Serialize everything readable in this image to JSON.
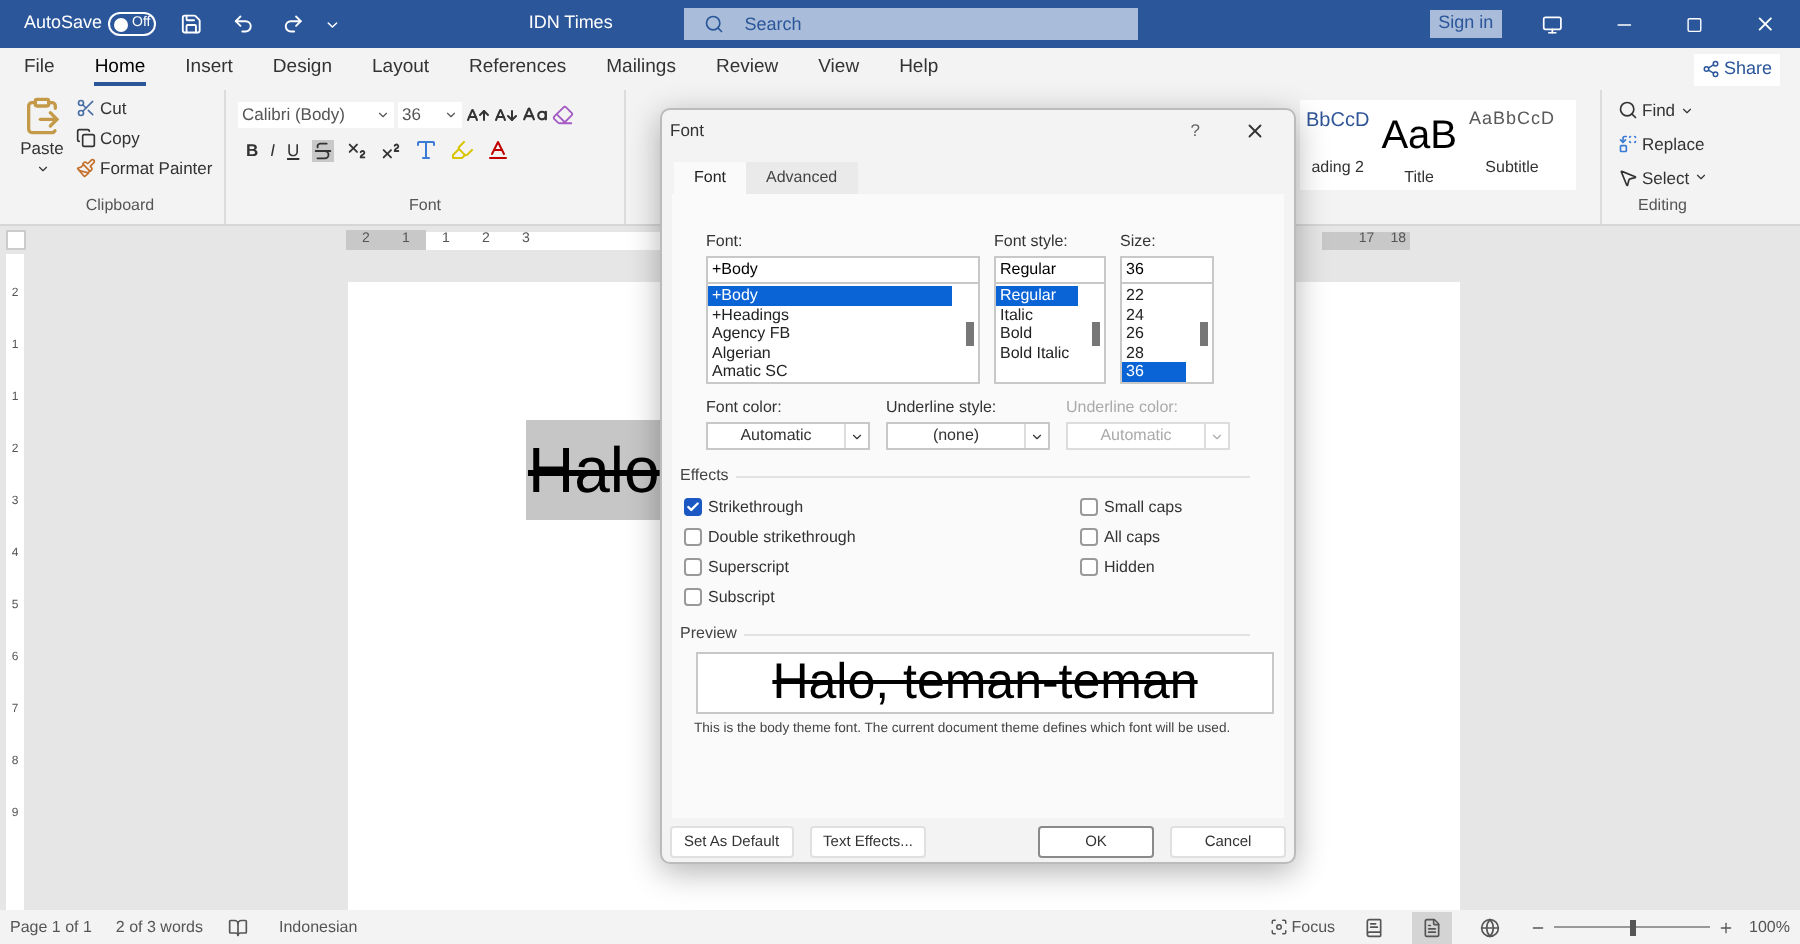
{
  "titlebar": {
    "autosave_label": "AutoSave",
    "autosave": {
      "on": false,
      "label": "Off"
    },
    "document_title": "IDN Times",
    "search": {
      "placeholder": "Search"
    },
    "sign_in": "Sign in"
  },
  "menu_tabs": [
    {
      "label": "File",
      "selected": false
    },
    {
      "label": "Home",
      "selected": true
    },
    {
      "label": "Insert",
      "selected": false
    },
    {
      "label": "Design",
      "selected": false
    },
    {
      "label": "Layout",
      "selected": false
    },
    {
      "label": "References",
      "selected": false
    },
    {
      "label": "Mailings",
      "selected": false
    },
    {
      "label": "Review",
      "selected": false
    },
    {
      "label": "View",
      "selected": false
    },
    {
      "label": "Help",
      "selected": false
    }
  ],
  "share": "Share",
  "ribbon": {
    "clipboard": {
      "paste": "Paste",
      "cut": "Cut",
      "copy": "Copy",
      "format_painter": "Format Painter",
      "group_label": "Clipboard"
    },
    "font": {
      "font_name": "Calibri (Body)",
      "font_size": "36",
      "bold": "B",
      "italic": "I",
      "underline": "U",
      "group_label": "Font"
    },
    "styles": [
      {
        "sample": "BbCcD",
        "name": "ading 2",
        "kind": "heading"
      },
      {
        "sample": "AaB",
        "name": "Title",
        "kind": "title"
      },
      {
        "sample": "AaBbCcD",
        "name": "Subtitle",
        "kind": "subtitle"
      }
    ],
    "editing": {
      "find": "Find",
      "replace": "Replace",
      "select": "Select",
      "group_label": "Editing"
    }
  },
  "ruler": {
    "left_numbers": [
      "2",
      "1",
      "1",
      "2",
      "3"
    ],
    "right_numbers": [
      "17",
      "18"
    ]
  },
  "vertical_ruler": {
    "numbers": [
      "2",
      "1",
      "1",
      "2",
      "3",
      "4",
      "5",
      "6",
      "7",
      "8",
      "9"
    ]
  },
  "document": {
    "text": "Halo",
    "selected": true,
    "strikethrough": true
  },
  "dialog": {
    "title": "Font",
    "help": "?",
    "tabs": [
      {
        "label": "Font",
        "selected": true
      },
      {
        "label": "Advanced",
        "selected": false
      }
    ],
    "font": {
      "label": "Font:",
      "value": "+Body",
      "items": [
        {
          "label": "+Body",
          "selected": true
        },
        {
          "label": "+Headings",
          "selected": false
        },
        {
          "label": "Agency FB",
          "selected": false
        },
        {
          "label": "Algerian",
          "selected": false
        },
        {
          "label": "Amatic SC",
          "selected": false
        }
      ]
    },
    "font_style": {
      "label": "Font style:",
      "value": "Regular",
      "items": [
        {
          "label": "Regular",
          "selected": true
        },
        {
          "label": "Italic",
          "selected": false
        },
        {
          "label": "Bold",
          "selected": false
        },
        {
          "label": "Bold Italic",
          "selected": false
        }
      ]
    },
    "size": {
      "label": "Size:",
      "value": "36",
      "items": [
        {
          "label": "22",
          "selected": false
        },
        {
          "label": "24",
          "selected": false
        },
        {
          "label": "26",
          "selected": false
        },
        {
          "label": "28",
          "selected": false
        },
        {
          "label": "36",
          "selected": true
        }
      ]
    },
    "dropdowns": [
      {
        "label": "Font color:",
        "value": "Automatic",
        "disabled": false
      },
      {
        "label": "Underline style:",
        "value": "(none)",
        "disabled": false
      },
      {
        "label": "Underline color:",
        "value": "Automatic",
        "disabled": true
      }
    ],
    "effects": {
      "label": "Effects",
      "left": [
        {
          "label": "Strikethrough",
          "checked": true
        },
        {
          "label": "Double strikethrough",
          "checked": false
        },
        {
          "label": "Superscript",
          "checked": false
        },
        {
          "label": "Subscript",
          "checked": false
        }
      ],
      "right": [
        {
          "label": "Small caps",
          "checked": false
        },
        {
          "label": "All caps",
          "checked": false
        },
        {
          "label": "Hidden",
          "checked": false
        }
      ]
    },
    "preview": {
      "label": "Preview",
      "text": "Halo, teman-teman",
      "strikethrough": true,
      "note": "This is the body theme font. The current document theme defines which font will be used."
    },
    "buttons": [
      {
        "label": "Set As Default",
        "kind": "secondary"
      },
      {
        "label": "Text Effects...",
        "kind": "secondary"
      },
      {
        "label": "OK",
        "kind": "primary"
      },
      {
        "label": "Cancel",
        "kind": "secondary"
      }
    ]
  },
  "status_bar": {
    "page": "Page 1 of 1",
    "words": "2 of 3 words",
    "language": "Indonesian",
    "focus": "Focus",
    "views": [
      {
        "kind": "read",
        "selected": false
      },
      {
        "kind": "print",
        "selected": true
      },
      {
        "kind": "web",
        "selected": false
      }
    ],
    "zoom": {
      "level": 0.5,
      "reading": "100%"
    }
  }
}
